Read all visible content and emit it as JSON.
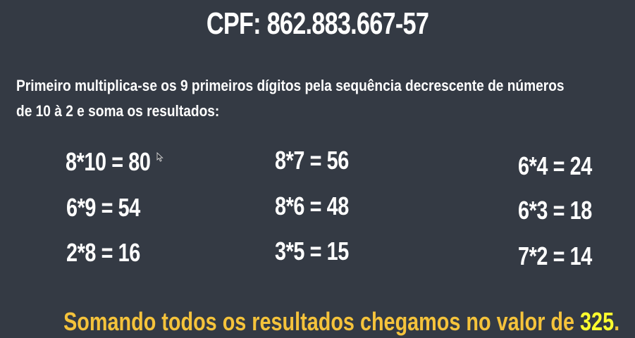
{
  "title": "CPF: 862.883.667-57",
  "intro": "Primeiro multiplica-se os 9 primeiros dígitos pela sequência decrescente de números de 10 à 2 e soma os resultados:",
  "equations": [
    "8*10 = 80",
    "6*9 = 54",
    "2*8 = 16",
    "8*7 = 56",
    "8*6 = 48",
    "3*5 = 15",
    "6*4 = 24",
    "6*3 = 18",
    "7*2 = 14"
  ],
  "summary": {
    "prefix": "Somando todos os resultados chegamos no valor de ",
    "total": "325",
    "suffix": "."
  },
  "colors": {
    "background": "#343a44",
    "summary_text": "#f5c33b",
    "total_highlight": "#ffff2e"
  },
  "icons": {
    "cursor": "mouse-pointer-icon"
  }
}
